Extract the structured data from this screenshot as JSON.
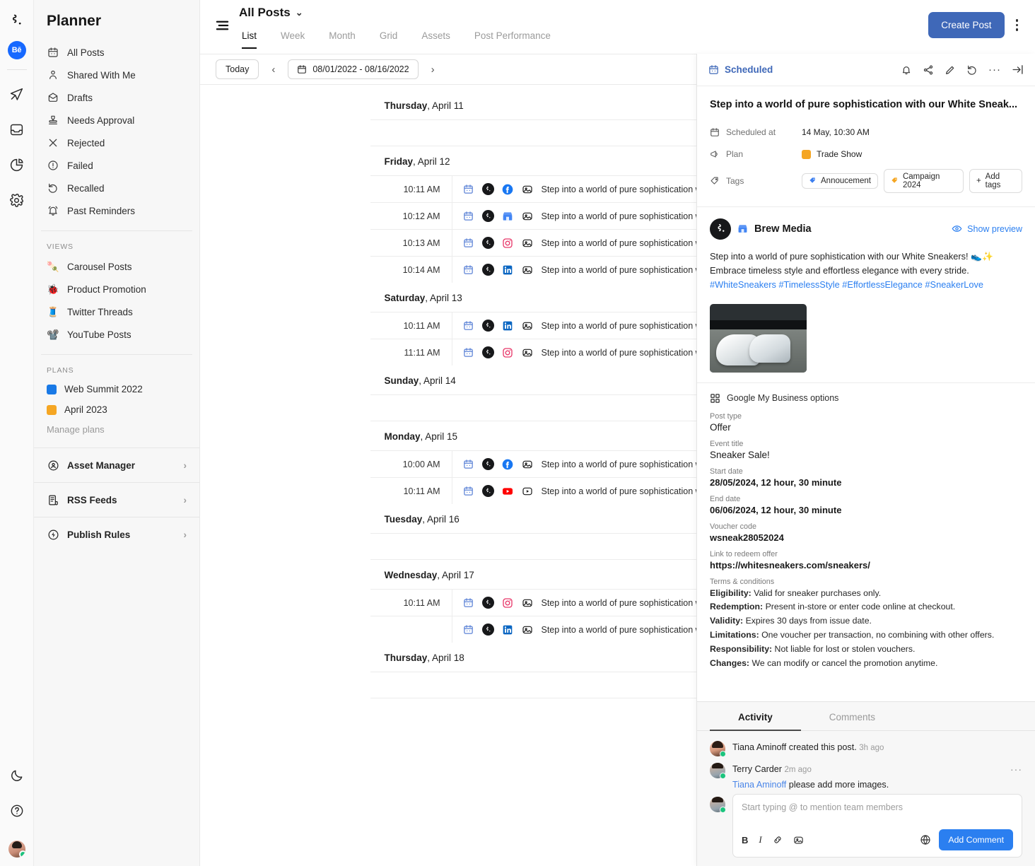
{
  "rail": {
    "logo_icon": "brand-logo-icon",
    "badge_label": "Bē",
    "icons": [
      {
        "name": "publish-icon",
        "label": "Publish"
      },
      {
        "name": "inbox-icon",
        "label": "Inbox"
      },
      {
        "name": "analytics-icon",
        "label": "Analytics"
      },
      {
        "name": "settings-icon",
        "label": "Settings"
      }
    ],
    "bottom_icons": [
      {
        "name": "dark-mode-icon",
        "label": "Dark mode"
      },
      {
        "name": "help-icon",
        "label": "Help"
      }
    ]
  },
  "sidebar": {
    "title": "Planner",
    "items": [
      {
        "label": "All Posts",
        "icon": "calendar-icon"
      },
      {
        "label": "Shared With Me",
        "icon": "person-icon"
      },
      {
        "label": "Drafts",
        "icon": "draft-icon"
      },
      {
        "label": "Needs Approval",
        "icon": "stamp-icon"
      },
      {
        "label": "Rejected",
        "icon": "close-icon"
      },
      {
        "label": "Failed",
        "icon": "alert-circle-icon"
      },
      {
        "label": "Recalled",
        "icon": "undo-icon"
      },
      {
        "label": "Past Reminders",
        "icon": "bell-icon"
      }
    ],
    "views_heading": "VIEWS",
    "views": [
      {
        "label": "Carousel Posts",
        "emoji": "🍡"
      },
      {
        "label": "Product Promotion",
        "emoji": "🐞"
      },
      {
        "label": "Twitter Threads",
        "emoji": "🧵"
      },
      {
        "label": "YouTube Posts",
        "emoji": "📽️"
      }
    ],
    "plans_heading": "PLANS",
    "plans": [
      {
        "label": "Web Summit 2022",
        "color": "#1979e6"
      },
      {
        "label": "April 2023",
        "color": "#f5a623"
      }
    ],
    "manage_plans": "Manage plans",
    "rows": [
      {
        "label": "Asset Manager",
        "icon": "asset-manager-icon",
        "chevron": "›"
      },
      {
        "label": "RSS Feeds",
        "icon": "rss-feeds-icon",
        "chevron": "›"
      },
      {
        "label": "Publish Rules",
        "icon": "publish-rules-icon",
        "chevron": "›"
      }
    ]
  },
  "header": {
    "menu_icon": "hamburger-icon",
    "title": "All Posts",
    "caret": "⌄",
    "tabs": [
      {
        "label": "List",
        "active": true
      },
      {
        "label": "Week",
        "active": false
      },
      {
        "label": "Month",
        "active": false
      },
      {
        "label": "Grid",
        "active": false
      },
      {
        "label": "Assets",
        "active": false
      },
      {
        "label": "Post Performance",
        "active": false
      }
    ],
    "create_post_label": "Create Post",
    "create_post_color": "#3f68b8",
    "overflow_icon": "kebab-menu-icon"
  },
  "toolbar": {
    "today_label": "Today",
    "prev_icon": "‹",
    "next_icon": "›",
    "date_range": "08/01/2022 - 08/16/2022",
    "calendar_icon": "calendar-icon"
  },
  "list": {
    "post_text": "Step into a world of pure sophistication with our Wh",
    "days": [
      {
        "weekday": "Thursday",
        "date": "April 11",
        "posts": []
      },
      {
        "weekday": "Friday",
        "date": "April 12",
        "posts": [
          {
            "time": "10:11 AM",
            "network": "facebook",
            "media": "image"
          },
          {
            "time": "10:12 AM",
            "network": "gmb",
            "media": "image"
          },
          {
            "time": "10:13 AM",
            "network": "instagram",
            "media": "image"
          },
          {
            "time": "10:14 AM",
            "network": "linkedin",
            "media": "image"
          }
        ]
      },
      {
        "weekday": "Saturday",
        "date": "April 13",
        "posts": [
          {
            "time": "10:11 AM",
            "network": "linkedin",
            "media": "image"
          },
          {
            "time": "11:11 AM",
            "network": "instagram",
            "media": "image"
          }
        ]
      },
      {
        "weekday": "Sunday",
        "date": "April 14",
        "posts": []
      },
      {
        "weekday": "Monday",
        "date": "April 15",
        "posts": [
          {
            "time": "10:00 AM",
            "network": "facebook",
            "media": "image"
          },
          {
            "time": "10:11 AM",
            "network": "youtube",
            "media": "video"
          }
        ]
      },
      {
        "weekday": "Tuesday",
        "date": "April 16",
        "posts": []
      },
      {
        "weekday": "Wednesday",
        "date": "April 17",
        "posts": [
          {
            "time": "10:11 AM",
            "network": "instagram",
            "media": "image"
          },
          {
            "time": "",
            "network": "linkedin",
            "media": "image"
          }
        ]
      },
      {
        "weekday": "Thursday",
        "date": "April 18",
        "posts": []
      }
    ]
  },
  "panel": {
    "status": "Scheduled",
    "status_color": "#3f68b8",
    "actions": [
      {
        "name": "notify-bell-icon"
      },
      {
        "name": "share-icon"
      },
      {
        "name": "edit-pencil-icon"
      },
      {
        "name": "revert-icon"
      },
      {
        "name": "more-options-icon"
      },
      {
        "name": "collapse-panel-icon"
      }
    ],
    "title": "Step into a world of pure sophistication with our White Sneak...",
    "meta": {
      "scheduled_at_label": "Scheduled at",
      "scheduled_at_value": "14 May, 10:30 AM",
      "plan_label": "Plan",
      "plan_value": "Trade Show",
      "plan_color": "#f5a623",
      "tags_label": "Tags",
      "tags": [
        {
          "label": "Annoucement",
          "color": "#3d7ff0"
        },
        {
          "label": "Campaign 2024",
          "color": "#f5a623"
        }
      ],
      "add_tags_label": "Add tags"
    },
    "account_name": "Brew Media",
    "account_network": "gmb",
    "show_preview_label": "Show preview",
    "post_body": "Step into a world of pure sophistication with our White Sneakers! 👟✨ Embrace timeless style and effortless elegance with every stride. ",
    "hashtags": "#WhiteSneakers #TimelessStyle #EffortlessElegance #SneakerLove",
    "gmb": {
      "heading": "Google My Business options",
      "fields": [
        {
          "label": "Post type",
          "value": "Offer",
          "regular": true
        },
        {
          "label": "Event title",
          "value": "Sneaker Sale!",
          "regular": true
        },
        {
          "label": "Start date",
          "value": "28/05/2024, 12 hour, 30 minute",
          "regular": false
        },
        {
          "label": "End date",
          "value": "06/06/2024, 12 hour, 30 minute",
          "regular": false
        },
        {
          "label": "Voucher code",
          "value": "wsneak28052024",
          "regular": false
        },
        {
          "label": "Link to redeem offer",
          "value": "https://whitesneakers.com/sneakers/",
          "regular": false
        }
      ],
      "terms_label": "Terms & conditions",
      "terms": [
        {
          "key": "Eligibility:",
          "text": " Valid for sneaker purchases only."
        },
        {
          "key": "Redemption:",
          "text": " Present in-store or enter code online at checkout."
        },
        {
          "key": "Validity:",
          "text": " Expires 30 days from issue date."
        },
        {
          "key": "Limitations:",
          "text": " One voucher per transaction, no combining with other offers."
        },
        {
          "key": "Responsibility:",
          "text": " Not liable for lost or stolen vouchers."
        },
        {
          "key": "Changes:",
          "text": " We can modify or cancel the promotion anytime."
        }
      ]
    },
    "activity": {
      "tabs": [
        {
          "label": "Activity",
          "active": true
        },
        {
          "label": "Comments",
          "active": false
        }
      ],
      "entries": [
        {
          "author": "Tiana Aminoff",
          "action": " created this post.",
          "time": "3h ago",
          "reply": null,
          "mention": null
        },
        {
          "author": "Terry Carder",
          "action": "",
          "time": "2m ago",
          "mention": "Tiana Aminoff",
          "reply": " please add more images."
        }
      ],
      "composer_placeholder": "Start typing @ to mention team members",
      "tools": [
        {
          "name": "bold-icon",
          "glyph": "B"
        },
        {
          "name": "italic-icon",
          "glyph": "I"
        },
        {
          "name": "link-icon",
          "glyph": "🔗"
        },
        {
          "name": "image-icon",
          "glyph": "🖼"
        }
      ],
      "globe_icon": "globe-icon",
      "add_comment_label": "Add Comment",
      "add_comment_color": "#2b7ff0"
    }
  }
}
